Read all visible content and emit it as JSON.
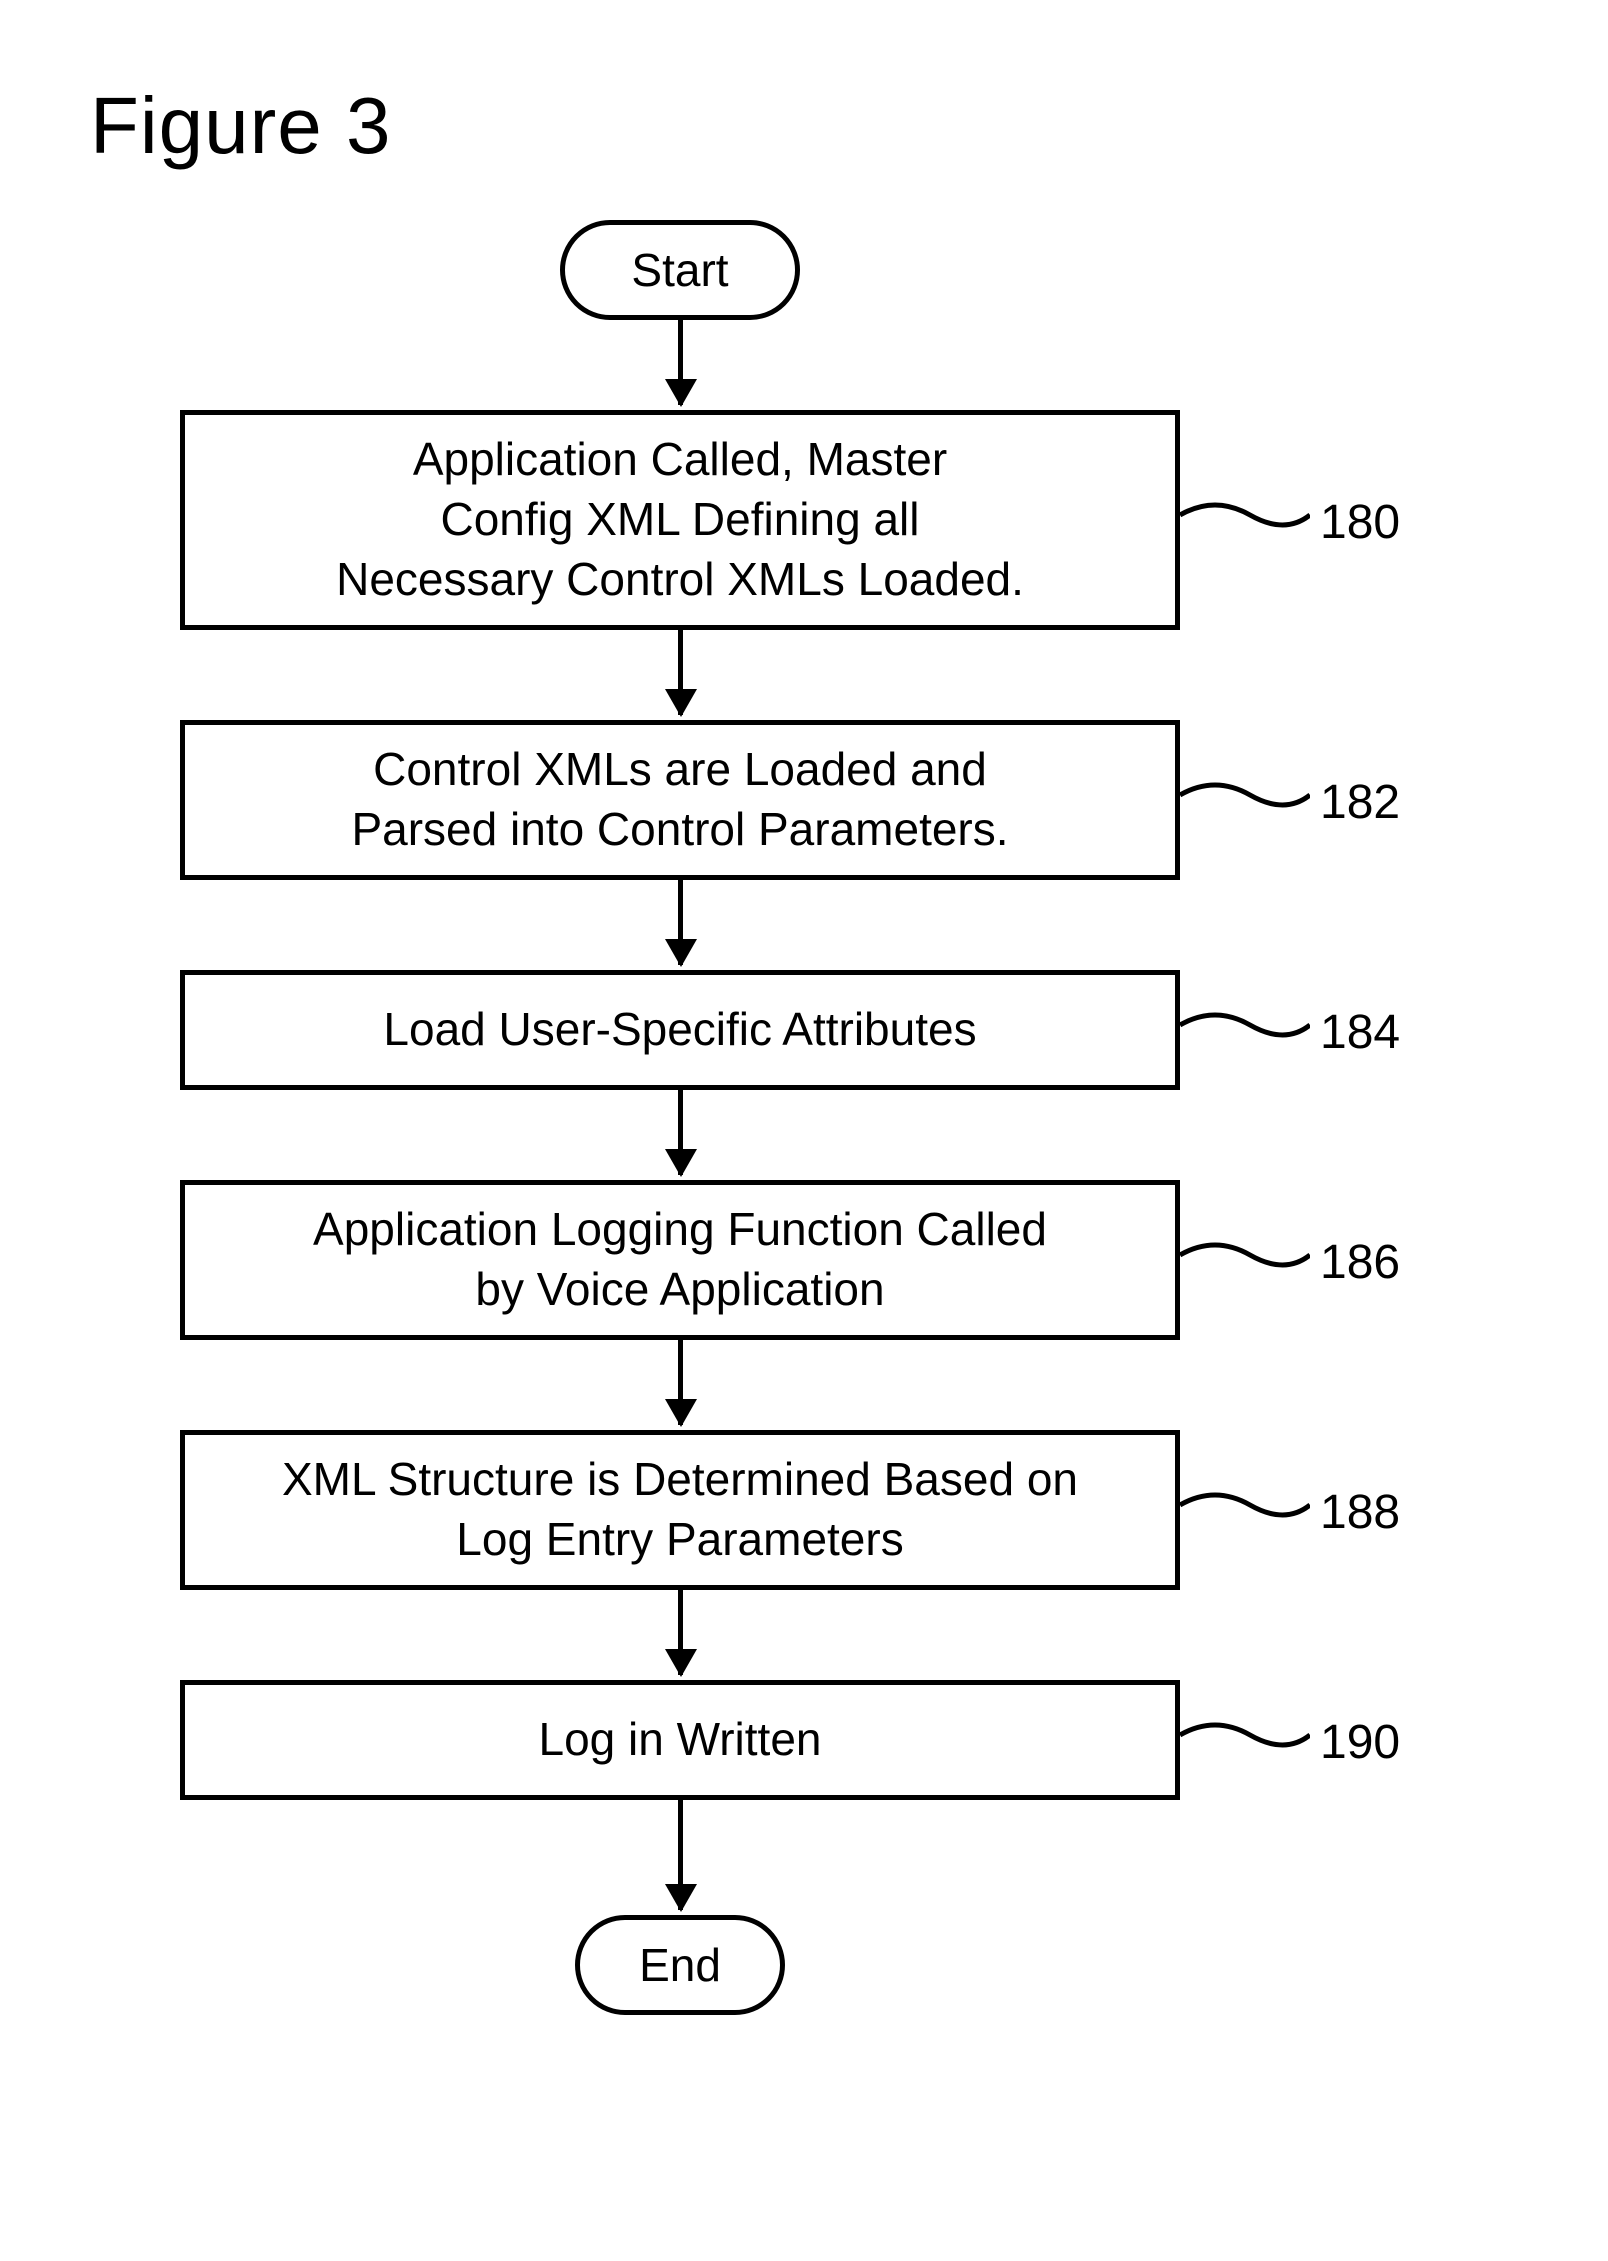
{
  "figure_title": "Figure 3",
  "terminators": {
    "start": "Start",
    "end": "End"
  },
  "steps": [
    {
      "ref": "180",
      "text": "Application Called, Master\nConfig XML Defining all\nNecessary Control XMLs Loaded."
    },
    {
      "ref": "182",
      "text": "Control XMLs are Loaded and\nParsed into Control Parameters."
    },
    {
      "ref": "184",
      "text": "Load User-Specific Attributes"
    },
    {
      "ref": "186",
      "text": "Application Logging Function Called\nby Voice Application"
    },
    {
      "ref": "188",
      "text": "XML Structure is Determined Based on\nLog Entry Parameters"
    },
    {
      "ref": "190",
      "text": "Log in Written"
    }
  ]
}
